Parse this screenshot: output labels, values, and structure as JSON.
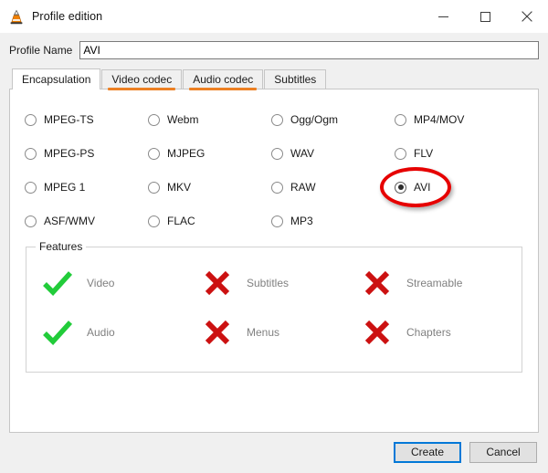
{
  "window": {
    "title": "Profile edition",
    "icon": "vlc-cone-icon",
    "controls": {
      "minimize": "minimize-icon",
      "maximize": "maximize-icon",
      "close": "close-icon"
    }
  },
  "profile": {
    "label": "Profile Name",
    "value": "AVI",
    "placeholder": ""
  },
  "tabs": [
    {
      "label": "Encapsulation",
      "active": true,
      "highlighted": false
    },
    {
      "label": "Video codec",
      "active": false,
      "highlighted": true
    },
    {
      "label": "Audio codec",
      "active": false,
      "highlighted": true
    },
    {
      "label": "Subtitles",
      "active": false,
      "highlighted": false
    }
  ],
  "encapsulation": {
    "columns": [
      {
        "items": [
          {
            "label": "MPEG-TS",
            "selected": false
          },
          {
            "label": "MPEG-PS",
            "selected": false
          },
          {
            "label": "MPEG 1",
            "selected": false
          },
          {
            "label": "ASF/WMV",
            "selected": false
          }
        ]
      },
      {
        "items": [
          {
            "label": "Webm",
            "selected": false
          },
          {
            "label": "MJPEG",
            "selected": false
          },
          {
            "label": "MKV",
            "selected": false
          },
          {
            "label": "FLAC",
            "selected": false
          }
        ]
      },
      {
        "items": [
          {
            "label": "Ogg/Ogm",
            "selected": false
          },
          {
            "label": "WAV",
            "selected": false
          },
          {
            "label": "RAW",
            "selected": false
          },
          {
            "label": "MP3",
            "selected": false
          }
        ]
      },
      {
        "items": [
          {
            "label": "MP4/MOV",
            "selected": false
          },
          {
            "label": "FLV",
            "selected": false
          },
          {
            "label": "AVI",
            "selected": true,
            "annotated": true
          }
        ]
      }
    ]
  },
  "features": {
    "legend": "Features",
    "columns": [
      {
        "items": [
          {
            "label": "Video",
            "state": "yes",
            "icon": "check-icon"
          },
          {
            "label": "Audio",
            "state": "yes",
            "icon": "check-icon"
          }
        ]
      },
      {
        "items": [
          {
            "label": "Subtitles",
            "state": "no",
            "icon": "cross-icon"
          },
          {
            "label": "Menus",
            "state": "no",
            "icon": "cross-icon"
          }
        ]
      },
      {
        "items": [
          {
            "label": "Streamable",
            "state": "no",
            "icon": "cross-icon"
          },
          {
            "label": "Chapters",
            "state": "no",
            "icon": "cross-icon"
          }
        ]
      }
    ]
  },
  "footer": {
    "create_label": "Create",
    "cancel_label": "Cancel"
  },
  "colors": {
    "accent_annotation": "#e60000",
    "tab_highlight": "#ec8024",
    "feature_yes": "#22cc3a",
    "feature_no": "#cc1111",
    "default_button_focus": "#0078d7"
  }
}
